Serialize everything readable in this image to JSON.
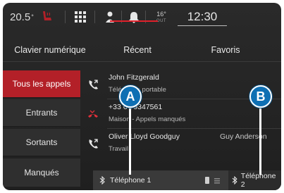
{
  "status_bar": {
    "temperature": "20.5",
    "temperature_unit": "°",
    "outside_temp": "16°",
    "outside_label": "OUT",
    "clock": "12:30"
  },
  "tabs": [
    {
      "label": "Clavier numérique"
    },
    {
      "label": "Récent",
      "selected": true
    },
    {
      "label": "Favoris"
    }
  ],
  "filters": [
    {
      "label": "Tous les appels",
      "selected": true
    },
    {
      "label": "Entrants"
    },
    {
      "label": "Sortants"
    },
    {
      "label": "Manqués"
    }
  ],
  "calls": [
    {
      "name": "John Fitzgerald",
      "sub": "Téléphone portable",
      "icon": "outgoing-call-icon"
    },
    {
      "name": "+33 6 79347561",
      "sub": "Maison - Appels manqués",
      "icon": "missed-call-icon"
    },
    {
      "name": "Oliver Lloyd Goodguy",
      "sub": "Travail",
      "overlay": "Guy Anderson",
      "icon": "outgoing-call-icon"
    }
  ],
  "phones": [
    {
      "label": "Téléphone 1",
      "active": true
    },
    {
      "label": "Téléphone 2"
    }
  ],
  "callouts": [
    "A",
    "B"
  ],
  "colors": {
    "accent_red": "#b32028",
    "tab_underline": "#e0202a",
    "callout_blue": "#0e6fb3",
    "missed_call": "#e0303a"
  }
}
